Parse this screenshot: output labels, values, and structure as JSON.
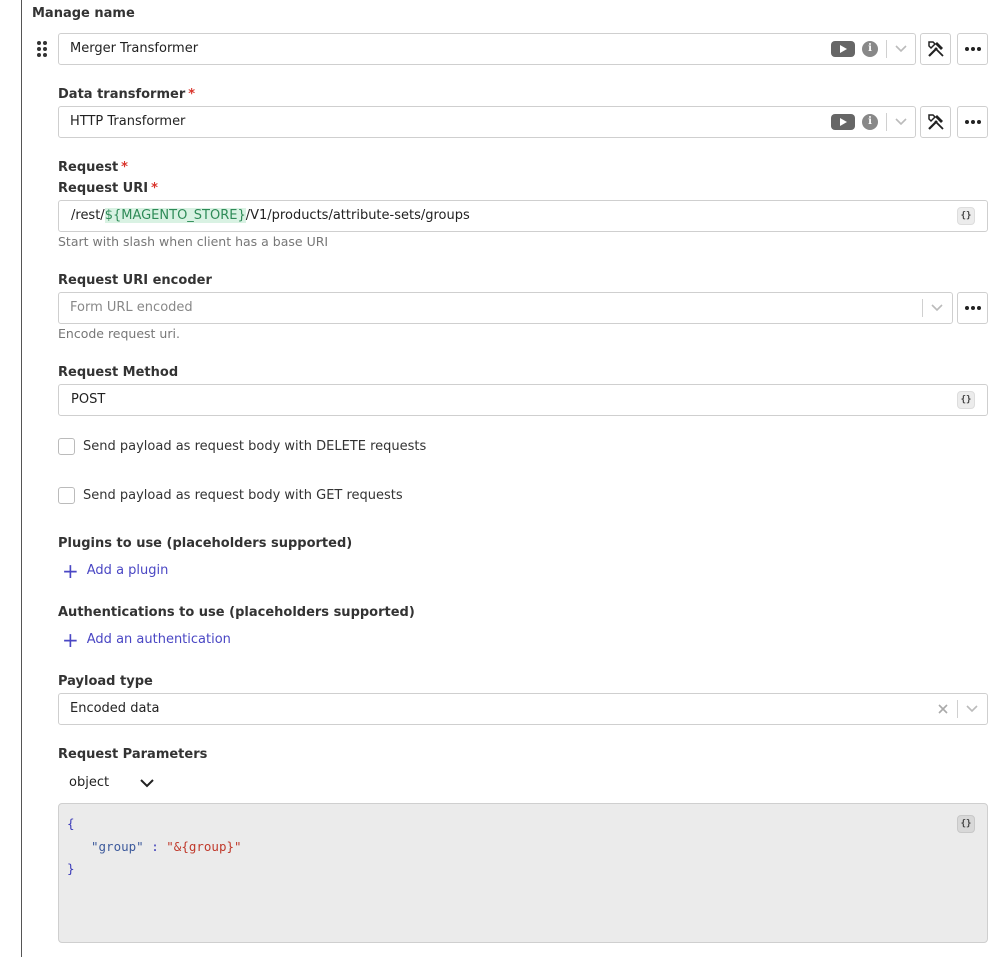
{
  "manage_name": {
    "label": "Manage name",
    "value": "Merger Transformer"
  },
  "data_transformer": {
    "label": "Data transformer",
    "required_mark": "*",
    "value": "HTTP Transformer"
  },
  "request": {
    "label": "Request",
    "required_mark": "*"
  },
  "request_uri": {
    "label": "Request URI",
    "required_mark": "*",
    "prefix": "/rest/",
    "token": "${MAGENTO_STORE}",
    "suffix": "/V1/products/attribute-sets/groups",
    "help": "Start with slash when client has a base URI",
    "placeholder_button": "{}"
  },
  "request_uri_encoder": {
    "label": "Request URI encoder",
    "placeholder": "Form URL encoded",
    "help": "Encode request uri."
  },
  "request_method": {
    "label": "Request Method",
    "value": "POST",
    "placeholder_button": "{}"
  },
  "checkboxes": {
    "delete_label": "Send payload as request body with DELETE requests",
    "get_label": "Send payload as request body with GET requests"
  },
  "plugins": {
    "label": "Plugins to use (placeholders supported)",
    "add_label": "Add a plugin"
  },
  "authentications": {
    "label": "Authentications to use (placeholders supported)",
    "add_label": "Add an authentication"
  },
  "payload_type": {
    "label": "Payload type",
    "value": "Encoded data"
  },
  "request_parameters": {
    "label": "Request Parameters",
    "type_value": "object",
    "placeholder_button": "{}",
    "code": {
      "open": "{",
      "key": "\"group\"",
      "colon": ":",
      "value": "\"&{group}\"",
      "close": "}"
    }
  },
  "icons": {
    "drag": "drag-handle-icon",
    "play": "play-icon",
    "info": "info-icon",
    "chevron": "chevron-down-icon",
    "tools": "tools-icon",
    "more": "more-dots-icon",
    "clear": "clear-icon",
    "plus": "plus-icon"
  },
  "colors": {
    "accent": "#4a47c4",
    "required": "#d9342b",
    "token_bg": "#d9f2e3",
    "token_fg": "#2e8b57"
  }
}
